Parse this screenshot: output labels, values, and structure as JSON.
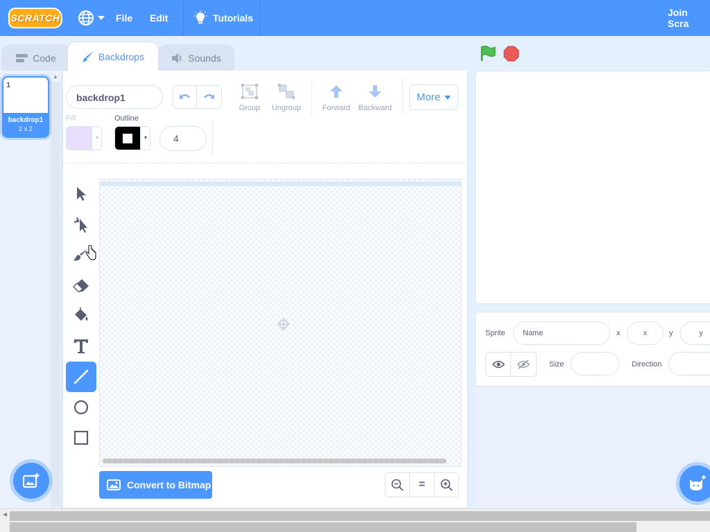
{
  "menubar": {
    "logo_text": "SCRATCH",
    "file": "File",
    "edit": "Edit",
    "tutorials": "Tutorials",
    "join": "Join Scra"
  },
  "tabs": {
    "code": "Code",
    "backdrops": "Backdrops",
    "sounds": "Sounds"
  },
  "backdrop_list": {
    "items": [
      {
        "number": "1",
        "name": "backdrop1",
        "size": "2 x 2"
      }
    ]
  },
  "editor": {
    "name_value": "backdrop1",
    "group": "Group",
    "ungroup": "Ungroup",
    "forward": "Forward",
    "backward": "Backward",
    "more": "More",
    "fill_label": "Fill",
    "outline_label": "Outline",
    "outline_width": "4",
    "convert_button": "Convert to Bitmap",
    "zoom_reset": "="
  },
  "colors": {
    "accent": "#4c97ff",
    "fill_swatch": "#e6d9fb",
    "outline_swatch": "#000000"
  },
  "sprite_info": {
    "sprite_label": "Sprite",
    "name_placeholder": "Name",
    "x_label": "x",
    "x_placeholder": "x",
    "y_label": "y",
    "y_placeholder": "y",
    "size_label": "Size",
    "direction_label": "Direction"
  }
}
